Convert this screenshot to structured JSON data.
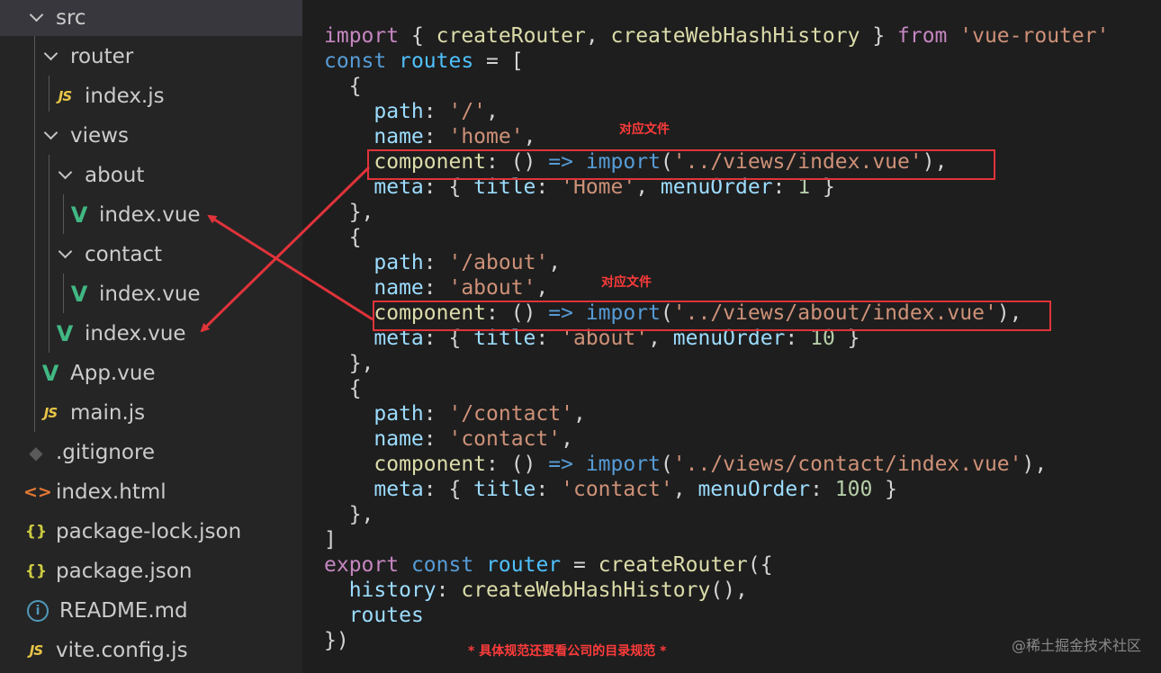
{
  "explorer": {
    "items": [
      {
        "label": "src",
        "icon": "chevron-down-icon"
      },
      {
        "label": "router",
        "icon": "chevron-down-icon"
      },
      {
        "label": "index.js",
        "icon": "js-file-icon",
        "glyph": "JS"
      },
      {
        "label": "views",
        "icon": "chevron-down-icon"
      },
      {
        "label": "about",
        "icon": "chevron-down-icon"
      },
      {
        "label": "index.vue",
        "icon": "vue-file-icon",
        "glyph": "V"
      },
      {
        "label": "contact",
        "icon": "chevron-down-icon"
      },
      {
        "label": "index.vue",
        "icon": "vue-file-icon",
        "glyph": "V"
      },
      {
        "label": "index.vue",
        "icon": "vue-file-icon",
        "glyph": "V"
      },
      {
        "label": "App.vue",
        "icon": "vue-file-icon",
        "glyph": "V"
      },
      {
        "label": "main.js",
        "icon": "js-file-icon",
        "glyph": "JS"
      },
      {
        "label": ".gitignore",
        "icon": "git-file-icon",
        "glyph": "◆"
      },
      {
        "label": "index.html",
        "icon": "html-file-icon",
        "glyph": "<>"
      },
      {
        "label": "package-lock.json",
        "icon": "json-file-icon",
        "glyph": "{}"
      },
      {
        "label": "package.json",
        "icon": "json-file-icon",
        "glyph": "{}"
      },
      {
        "label": "README.md",
        "icon": "info-file-icon",
        "glyph": "i"
      },
      {
        "label": "vite.config.js",
        "icon": "js-file-icon",
        "glyph": "JS"
      }
    ]
  },
  "code": {
    "lines": [
      [
        [
          "kc",
          "import"
        ],
        [
          "pn",
          " { "
        ],
        [
          "fn",
          "createRouter"
        ],
        [
          "pn",
          ", "
        ],
        [
          "fn",
          "createWebHashHistory"
        ],
        [
          "pn",
          " } "
        ],
        [
          "kc",
          "from"
        ],
        [
          "pn",
          " "
        ],
        [
          "st",
          "'vue-router'"
        ]
      ],
      [
        [
          "kw",
          "const"
        ],
        [
          "pn",
          " "
        ],
        [
          "var",
          "routes"
        ],
        [
          "pn",
          " = ["
        ]
      ],
      [
        [
          "pn",
          "  {"
        ]
      ],
      [
        [
          "pn",
          "    "
        ],
        [
          "pr",
          "path"
        ],
        [
          "pn",
          ": "
        ],
        [
          "st",
          "'/'"
        ],
        [
          "pn",
          ","
        ]
      ],
      [
        [
          "pn",
          "    "
        ],
        [
          "pr",
          "name"
        ],
        [
          "pn",
          ": "
        ],
        [
          "st",
          "'home'"
        ],
        [
          "pn",
          ","
        ]
      ],
      [
        [
          "pn",
          "    "
        ],
        [
          "fn",
          "component"
        ],
        [
          "pn",
          ": () "
        ],
        [
          "kw",
          "=>"
        ],
        [
          "pn",
          " "
        ],
        [
          "kw",
          "import"
        ],
        [
          "pn",
          "("
        ],
        [
          "st",
          "'../views/index.vue'"
        ],
        [
          "pn",
          "),"
        ]
      ],
      [
        [
          "pn",
          "    "
        ],
        [
          "pr",
          "meta"
        ],
        [
          "pn",
          ": { "
        ],
        [
          "pr",
          "title"
        ],
        [
          "pn",
          ": "
        ],
        [
          "st",
          "'Home'"
        ],
        [
          "pn",
          ", "
        ],
        [
          "pr",
          "menuOrder"
        ],
        [
          "pn",
          ": "
        ],
        [
          "nm",
          "1"
        ],
        [
          "pn",
          " }"
        ]
      ],
      [
        [
          "pn",
          "  },"
        ]
      ],
      [
        [
          "pn",
          "  {"
        ]
      ],
      [
        [
          "pn",
          "    "
        ],
        [
          "pr",
          "path"
        ],
        [
          "pn",
          ": "
        ],
        [
          "st",
          "'/about'"
        ],
        [
          "pn",
          ","
        ]
      ],
      [
        [
          "pn",
          "    "
        ],
        [
          "pr",
          "name"
        ],
        [
          "pn",
          ": "
        ],
        [
          "st",
          "'about'"
        ],
        [
          "pn",
          ","
        ]
      ],
      [
        [
          "pn",
          "    "
        ],
        [
          "fn",
          "component"
        ],
        [
          "pn",
          ": () "
        ],
        [
          "kw",
          "=>"
        ],
        [
          "pn",
          " "
        ],
        [
          "kw",
          "import"
        ],
        [
          "pn",
          "("
        ],
        [
          "st",
          "'../views/about/index.vue'"
        ],
        [
          "pn",
          "),"
        ]
      ],
      [
        [
          "pn",
          "    "
        ],
        [
          "pr",
          "meta"
        ],
        [
          "pn",
          ": { "
        ],
        [
          "pr",
          "title"
        ],
        [
          "pn",
          ": "
        ],
        [
          "st",
          "'about'"
        ],
        [
          "pn",
          ", "
        ],
        [
          "pr",
          "menuOrder"
        ],
        [
          "pn",
          ": "
        ],
        [
          "nm",
          "10"
        ],
        [
          "pn",
          " }"
        ]
      ],
      [
        [
          "pn",
          "  },"
        ]
      ],
      [
        [
          "pn",
          "  {"
        ]
      ],
      [
        [
          "pn",
          "    "
        ],
        [
          "pr",
          "path"
        ],
        [
          "pn",
          ": "
        ],
        [
          "st",
          "'/contact'"
        ],
        [
          "pn",
          ","
        ]
      ],
      [
        [
          "pn",
          "    "
        ],
        [
          "pr",
          "name"
        ],
        [
          "pn",
          ": "
        ],
        [
          "st",
          "'contact'"
        ],
        [
          "pn",
          ","
        ]
      ],
      [
        [
          "pn",
          "    "
        ],
        [
          "fn",
          "component"
        ],
        [
          "pn",
          ": () "
        ],
        [
          "kw",
          "=>"
        ],
        [
          "pn",
          " "
        ],
        [
          "kw",
          "import"
        ],
        [
          "pn",
          "("
        ],
        [
          "st",
          "'../views/contact/index.vue'"
        ],
        [
          "pn",
          "),"
        ]
      ],
      [
        [
          "pn",
          "    "
        ],
        [
          "pr",
          "meta"
        ],
        [
          "pn",
          ": { "
        ],
        [
          "pr",
          "title"
        ],
        [
          "pn",
          ": "
        ],
        [
          "st",
          "'contact'"
        ],
        [
          "pn",
          ", "
        ],
        [
          "pr",
          "menuOrder"
        ],
        [
          "pn",
          ": "
        ],
        [
          "nm",
          "100"
        ],
        [
          "pn",
          " }"
        ]
      ],
      [
        [
          "pn",
          "  },"
        ]
      ],
      [
        [
          "pn",
          "]"
        ]
      ],
      [
        [
          "kc",
          "export"
        ],
        [
          "pn",
          " "
        ],
        [
          "kw",
          "const"
        ],
        [
          "pn",
          " "
        ],
        [
          "var",
          "router"
        ],
        [
          "pn",
          " = "
        ],
        [
          "fn",
          "createRouter"
        ],
        [
          "pn",
          "({"
        ]
      ],
      [
        [
          "pn",
          "  "
        ],
        [
          "pr",
          "history"
        ],
        [
          "pn",
          ": "
        ],
        [
          "fn",
          "createWebHashHistory"
        ],
        [
          "pn",
          "(),"
        ]
      ],
      [
        [
          "pn",
          "  "
        ],
        [
          "pr",
          "routes"
        ]
      ],
      [
        [
          "pn",
          "})"
        ]
      ]
    ]
  },
  "annotations": {
    "note_home": "对应文件",
    "note_about": "对应文件",
    "footer_note": "* 具体规范还要看公司的目录规范 *"
  },
  "watermark": "@稀土掘金技术社区",
  "colors": {
    "highlight": "#e0333a",
    "arrow": "#e0333a",
    "vue": "#41b883",
    "js": "#e8c547"
  }
}
